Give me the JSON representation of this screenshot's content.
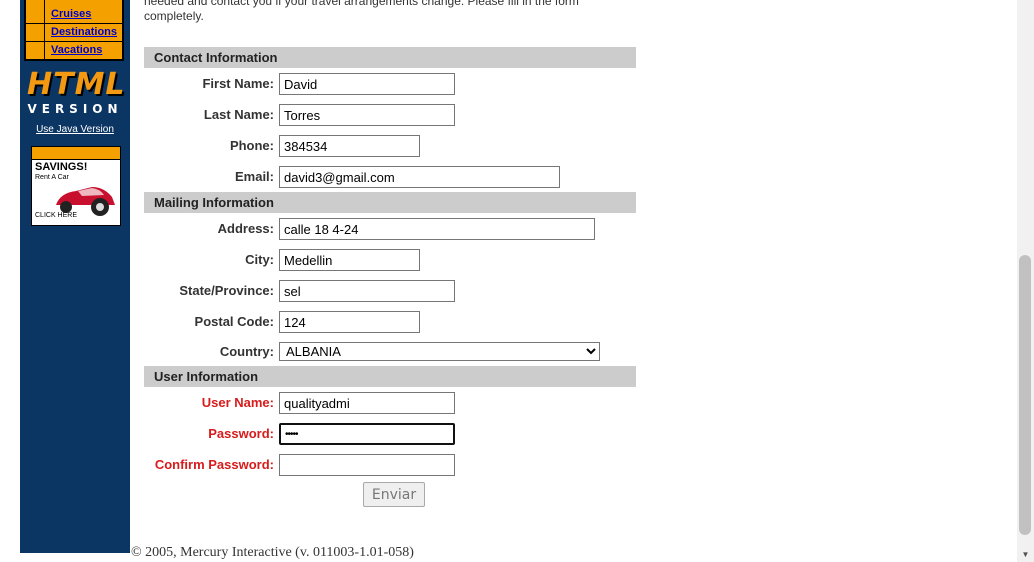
{
  "sidebar": {
    "nav_items": [
      {
        "label": "Cruises"
      },
      {
        "label": "Destinations"
      },
      {
        "label": "Vacations"
      }
    ],
    "logo_text": "HTML",
    "logo_sub": "VERSION",
    "java_link": "Use Java Version",
    "ad": {
      "title": "SAVINGS!",
      "subtitle": "Rent A Car",
      "cta": "CLICK HERE"
    }
  },
  "intro_text": "needed and contact you if your travel arrangements change. Please fill in the form completely.",
  "sections": {
    "contact": "Contact Information",
    "mailing": "Mailing Information",
    "user": "User Information"
  },
  "fields": {
    "first_name": {
      "label": "First Name:",
      "value": "David"
    },
    "last_name": {
      "label": "Last Name:",
      "value": "Torres"
    },
    "phone": {
      "label": "Phone:",
      "value": "384534"
    },
    "email": {
      "label": "Email:",
      "value": "david3@gmail.com"
    },
    "address": {
      "label": "Address:",
      "value": "calle 18 4-24"
    },
    "city": {
      "label": "City:",
      "value": "Medellin"
    },
    "state": {
      "label": "State/Province:",
      "value": "sel"
    },
    "postal": {
      "label": "Postal Code:",
      "value": "124"
    },
    "country": {
      "label": "Country:",
      "value": "ALBANIA"
    },
    "username": {
      "label": "User Name:",
      "value": "qualityadmi"
    },
    "password": {
      "label": "Password:",
      "value": "•••••"
    },
    "confirm": {
      "label": "Confirm Password:",
      "value": ""
    }
  },
  "submit_label": "Enviar",
  "footer": "© 2005, Mercury Interactive (v. 011003-1.01-058)",
  "colors": {
    "sidebar": "#0b3563",
    "accent": "#f4a100",
    "required": "#d81b1b"
  }
}
